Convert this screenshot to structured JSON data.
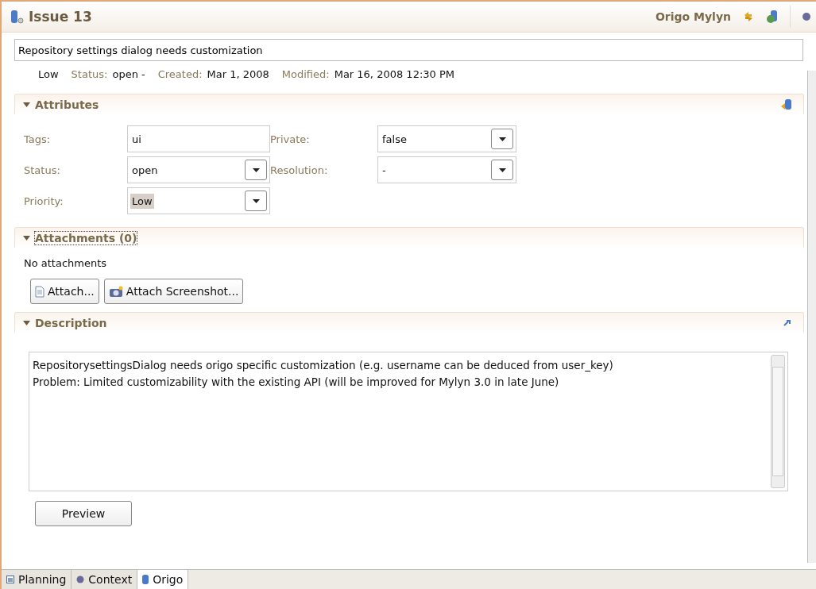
{
  "header": {
    "title": "Issue 13",
    "connector": "Origo Mylyn"
  },
  "summary": {
    "value": "Repository settings dialog needs customization"
  },
  "meta": [
    {
      "value": "Low"
    },
    {
      "label": "Status:",
      "value": "open  -"
    },
    {
      "label": "Created:",
      "value": "Mar 1, 2008"
    },
    {
      "label": "Modified:",
      "value": "Mar 16, 2008 12:30 PM"
    }
  ],
  "attributes": {
    "title": "Attributes",
    "expanded": true,
    "fields": [
      {
        "label": "Tags:",
        "value": "ui",
        "kind": "text",
        "highlighted": false
      },
      {
        "label": "Private:",
        "value": "false",
        "kind": "combo",
        "highlighted": false
      },
      {
        "label": "Status:",
        "value": "open",
        "kind": "combo",
        "highlighted": false
      },
      {
        "label": "Resolution:",
        "value": "-",
        "kind": "combo",
        "highlighted": false
      },
      {
        "label": "Priority:",
        "value": "Low",
        "kind": "combo",
        "highlighted": true
      }
    ]
  },
  "attachments": {
    "title": "Attachments (0)",
    "expanded": true,
    "empty_text": "No attachments",
    "buttons": [
      "Attach...",
      "Attach Screenshot..."
    ]
  },
  "description": {
    "title": "Description",
    "expanded": true,
    "lines": [
      "RepositorysettingsDialog needs origo specific customization (e.g. username can be deduced from user_key)",
      "Problem: Limited customizability with the existing API (will be improved for Mylyn 3.0 in late June)"
    ],
    "button": "Preview"
  },
  "tabs": [
    {
      "label": "Planning",
      "selected": false
    },
    {
      "label": "Context",
      "selected": false
    },
    {
      "label": "Origo",
      "selected": true
    }
  ]
}
